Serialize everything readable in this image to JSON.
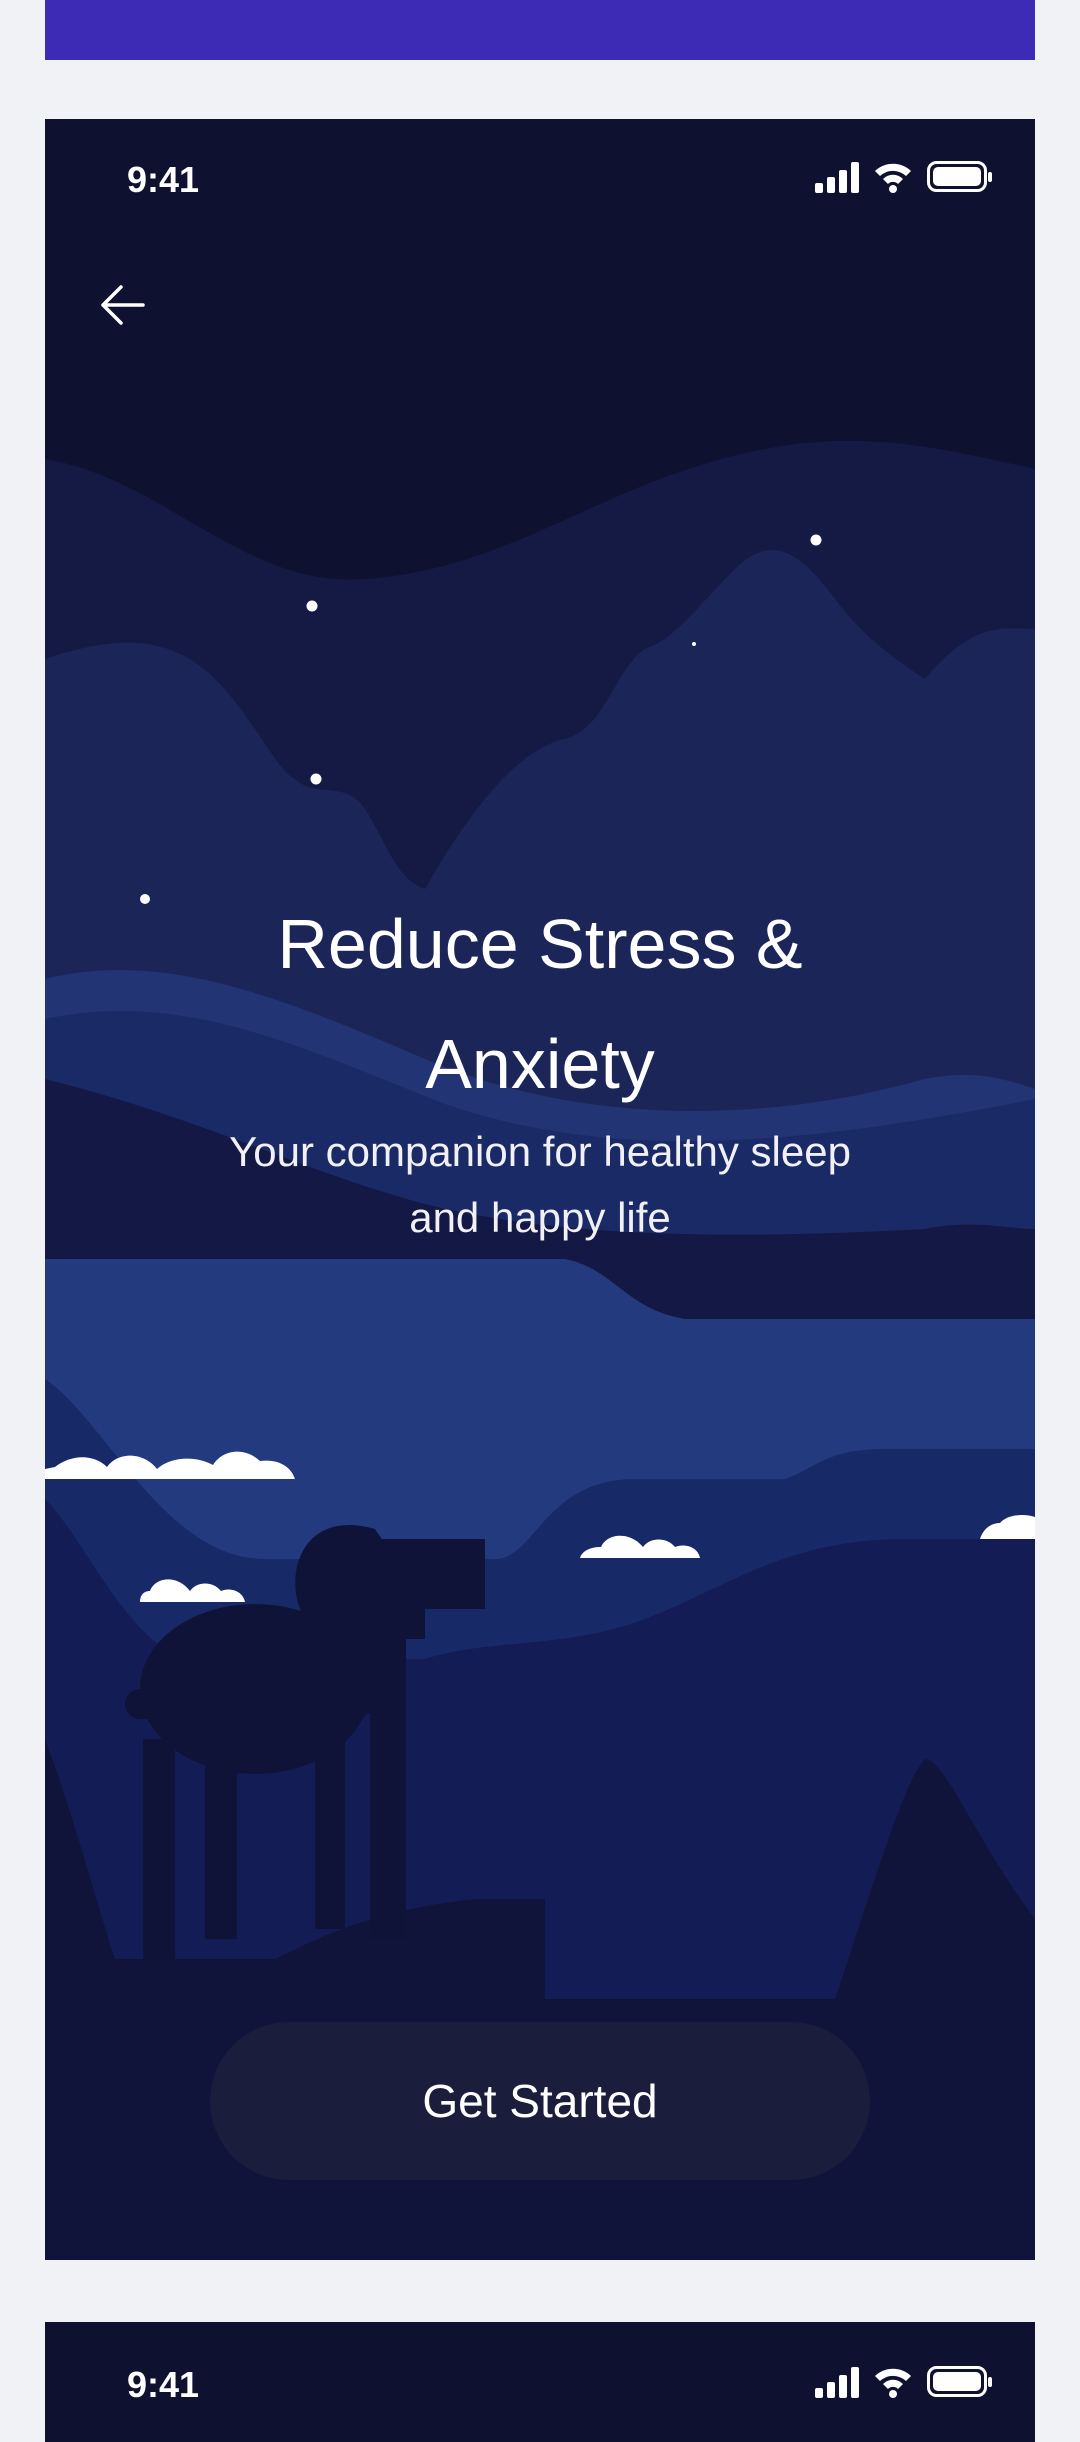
{
  "app": {
    "status_time": "9:41",
    "title": "Reduce Stress & Anxiety",
    "title_line1": "Reduce Stress &",
    "title_line2": "Anxiety",
    "subtitle_line1": "Your companion for healthy sleep",
    "subtitle_line2": "and happy life",
    "cta_label": "Get Started"
  },
  "next_screen": {
    "status_time": "9:41"
  },
  "icons": {
    "back": "arrow-left-icon",
    "signal": "signal-bars-icon",
    "wifi": "wifi-icon",
    "battery": "battery-icon"
  },
  "colors": {
    "accent_bar": "#3d2bb5",
    "screen_bg": "#0f1130",
    "cta_bg": "#1b1d3d",
    "page_bg": "#f1f2f5"
  }
}
